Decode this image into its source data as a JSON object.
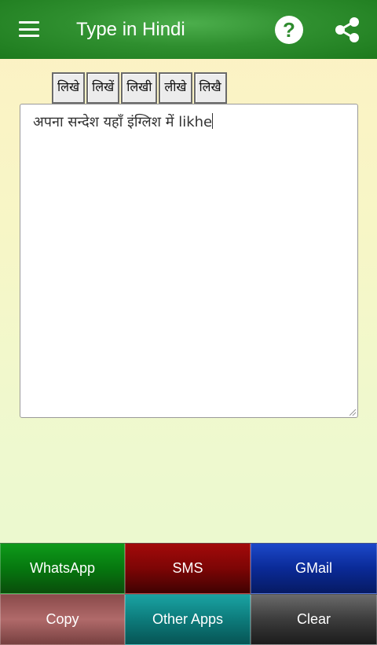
{
  "appbar": {
    "title": "Type in Hindi",
    "menu_icon": "hamburger-menu-icon",
    "help_icon": "help-icon",
    "help_glyph": "?",
    "share_icon": "share-icon"
  },
  "suggestions": [
    "लिखे",
    "लिखें",
    "लिखी",
    "लीखे",
    "लिखै"
  ],
  "editor": {
    "text": "अपना सन्देश यहाँ इंग्लिश में likhe"
  },
  "buttons": {
    "whatsapp": "WhatsApp",
    "sms": "SMS",
    "gmail": "GMail",
    "copy": "Copy",
    "other_apps": "Other Apps",
    "clear": "Clear"
  },
  "colors": {
    "appbar": "#2f8f2f",
    "whatsapp": "#06780f",
    "sms": "#7d0505",
    "gmail": "#0a2a97",
    "copy": "#b06a6a",
    "other_apps": "#0d7b7b",
    "clear": "#3c3c3c"
  }
}
